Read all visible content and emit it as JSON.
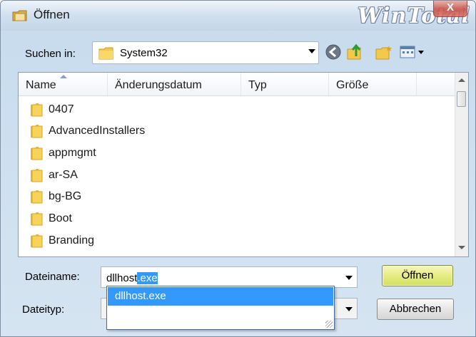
{
  "window": {
    "title": "Öffnen",
    "brand": "WinTotal",
    "close_glyph": "X"
  },
  "toolbar": {
    "look_in_label": "Suchen in:",
    "look_in_value": "System32",
    "icons": [
      "back-icon",
      "up-folder-icon",
      "new-folder-icon",
      "views-menu-icon"
    ]
  },
  "file_list": {
    "columns": [
      "Name",
      "Änderungsdatum",
      "Typ",
      "Größe"
    ],
    "items": [
      {
        "name": "0407"
      },
      {
        "name": "AdvancedInstallers"
      },
      {
        "name": "appmgmt"
      },
      {
        "name": "ar-SA"
      },
      {
        "name": "bg-BG"
      },
      {
        "name": "Boot"
      },
      {
        "name": "Branding"
      }
    ]
  },
  "filename": {
    "label": "Dateiname:",
    "typed": "dllhost",
    "selected_suffix": ".exe"
  },
  "filetype": {
    "label": "Dateityp:",
    "value": ""
  },
  "autocomplete": {
    "items": [
      "dllhost.exe"
    ]
  },
  "buttons": {
    "open": "Öffnen",
    "cancel": "Abbrechen"
  },
  "colors": {
    "folder": "#f2c94c",
    "selection": "#3399ff",
    "open_button": "#e5ec82"
  }
}
